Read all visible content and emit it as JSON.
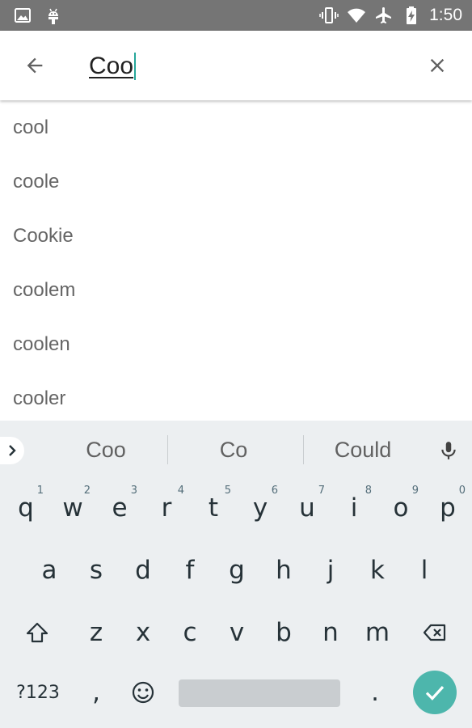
{
  "status_bar": {
    "time": "1:50",
    "icons": [
      "image-icon",
      "android-icon",
      "vibrate-icon",
      "wifi-icon",
      "airplane-icon",
      "battery-charging-icon"
    ]
  },
  "search": {
    "value": "Coo"
  },
  "suggestions": [
    "cool",
    "coole",
    "Cookie",
    "coolem",
    "coolen",
    "cooler"
  ],
  "keyboard": {
    "word_suggestions": [
      "Coo",
      "Co",
      "Could"
    ],
    "row1": [
      {
        "char": "q",
        "hint": "1"
      },
      {
        "char": "w",
        "hint": "2"
      },
      {
        "char": "e",
        "hint": "3"
      },
      {
        "char": "r",
        "hint": "4"
      },
      {
        "char": "t",
        "hint": "5"
      },
      {
        "char": "y",
        "hint": "6"
      },
      {
        "char": "u",
        "hint": "7"
      },
      {
        "char": "i",
        "hint": "8"
      },
      {
        "char": "o",
        "hint": "9"
      },
      {
        "char": "p",
        "hint": "0"
      }
    ],
    "row2": [
      "a",
      "s",
      "d",
      "f",
      "g",
      "h",
      "j",
      "k",
      "l"
    ],
    "row3": [
      "z",
      "x",
      "c",
      "v",
      "b",
      "n",
      "m"
    ],
    "symbols_key": "?123",
    "comma_key": ",",
    "period_key": ".",
    "colors": {
      "background": "#eceff1",
      "accent": "#4db6ac",
      "key_text": "#263238"
    }
  }
}
